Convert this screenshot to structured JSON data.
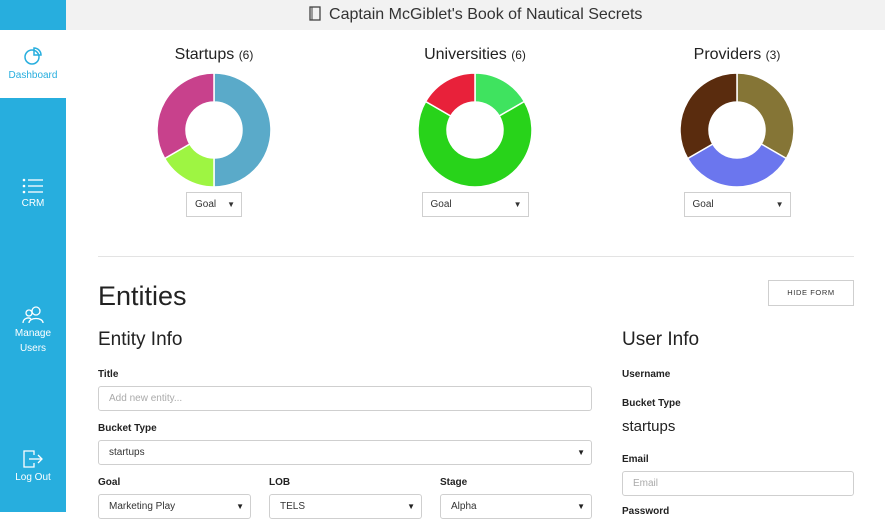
{
  "app": {
    "title": "Captain McGiblet's Book of Nautical Secrets"
  },
  "sidebar": {
    "items": [
      {
        "label": "Dashboard",
        "icon": "pie-chart-icon",
        "active": true
      },
      {
        "label": "CRM",
        "icon": "list-icon"
      },
      {
        "label": "Manage Users",
        "icon": "users-icon"
      },
      {
        "label": "Log Out",
        "icon": "logout-icon"
      }
    ]
  },
  "charts": [
    {
      "title": "Startups",
      "count": "(6)",
      "select_value": "Goal",
      "chart_data": {
        "type": "pie",
        "values": [
          3,
          1,
          2
        ],
        "colors": [
          "#5aaac9",
          "#9ef542",
          "#c8418c"
        ]
      }
    },
    {
      "title": "Universities",
      "count": "(6)",
      "select_value": "Goal",
      "chart_data": {
        "type": "pie",
        "values": [
          1,
          4,
          1
        ],
        "colors": [
          "#3fe35f",
          "#28d31a",
          "#e8213a"
        ]
      }
    },
    {
      "title": "Providers",
      "count": "(3)",
      "select_value": "Goal",
      "chart_data": {
        "type": "pie",
        "values": [
          1,
          1,
          1
        ],
        "colors": [
          "#857536",
          "#6b76ee",
          "#5a2c0e"
        ]
      }
    }
  ],
  "entities": {
    "heading": "Entities",
    "hide_form_label": "HIDE FORM",
    "entity_info": {
      "heading": "Entity Info",
      "title_label": "Title",
      "title_placeholder": "Add new entity...",
      "bucket_label": "Bucket Type",
      "bucket_value": "startups",
      "goal_label": "Goal",
      "goal_value": "Marketing Play",
      "lob_label": "LOB",
      "lob_value": "TELS",
      "stage_label": "Stage",
      "stage_value": "Alpha"
    },
    "user_info": {
      "heading": "User Info",
      "username_label": "Username",
      "bucket_label": "Bucket Type",
      "bucket_value": "startups",
      "email_label": "Email",
      "email_placeholder": "Email",
      "password_label": "Password"
    }
  }
}
